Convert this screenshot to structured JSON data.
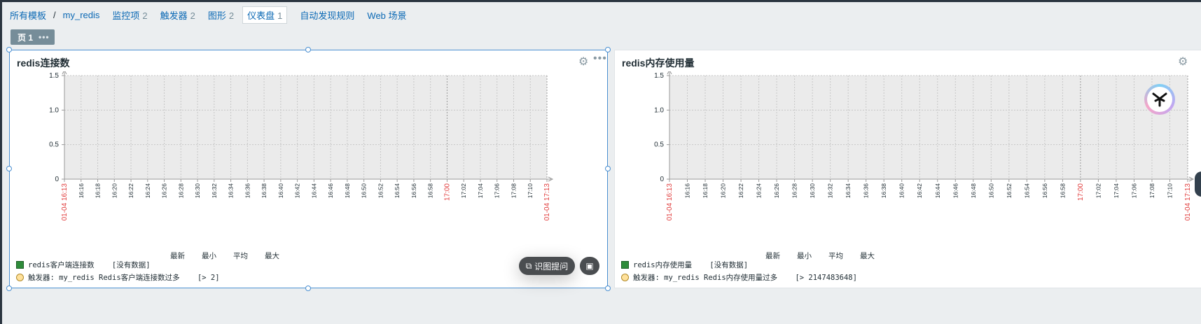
{
  "nav": {
    "all_templates": "所有模板",
    "separator": "/",
    "template_name": "my_redis",
    "items": [
      {
        "label": "监控项",
        "count": "2"
      },
      {
        "label": "触发器",
        "count": "2"
      },
      {
        "label": "图形",
        "count": "2"
      },
      {
        "label": "仪表盘",
        "count": "1"
      },
      {
        "label": "自动发现规则",
        "count": ""
      },
      {
        "label": "Web 场景",
        "count": ""
      }
    ]
  },
  "page_tab": {
    "label": "页 1",
    "more": "•••"
  },
  "widgets": [
    {
      "title": "redis连接数",
      "legend_header": [
        "最新",
        "最小",
        "平均",
        "最大"
      ],
      "item": {
        "name": "redis客户端连接数",
        "status": "[没有数据]"
      },
      "trigger": {
        "label": "触发器: my_redis Redis客户端连接数过多",
        "condition": "[> 2]"
      }
    },
    {
      "title": "redis内存使用量",
      "legend_header": [
        "最新",
        "最小",
        "平均",
        "最大"
      ],
      "item": {
        "name": "redis内存使用量",
        "status": "[没有数据]"
      },
      "trigger": {
        "label": "触发器: my_redis Redis内存使用量过多",
        "condition": "[> 2147483648]"
      }
    }
  ],
  "chart_data": [
    {
      "type": "line",
      "title": "redis连接数",
      "y_ticks": [
        "1.5",
        "1.0",
        "0.5",
        "0"
      ],
      "ylim": [
        0,
        1.5
      ],
      "x_ticks": [
        "01-04 16:13",
        "16:16",
        "16:18",
        "16:20",
        "16:22",
        "16:24",
        "16:26",
        "16:28",
        "16:30",
        "16:32",
        "16:34",
        "16:36",
        "16:38",
        "16:40",
        "16:42",
        "16:44",
        "16:46",
        "16:48",
        "16:50",
        "16:52",
        "16:54",
        "16:56",
        "16:58",
        "17:00",
        "17:02",
        "17:04",
        "17:06",
        "17:08",
        "17:10",
        "01-04 17:13"
      ],
      "x_highlight": [
        "01-04 16:13",
        "17:00",
        "01-04 17:13"
      ],
      "highlight_color": "#e03a3a",
      "grid": true,
      "series": []
    },
    {
      "type": "line",
      "title": "redis内存使用量",
      "y_ticks": [
        "1.5",
        "1.0",
        "0.5",
        "0"
      ],
      "ylim": [
        0,
        1.5
      ],
      "x_ticks": [
        "01-04 16:13",
        "16:16",
        "16:18",
        "16:20",
        "16:22",
        "16:24",
        "16:26",
        "16:28",
        "16:30",
        "16:32",
        "16:34",
        "16:36",
        "16:38",
        "16:40",
        "16:42",
        "16:44",
        "16:46",
        "16:48",
        "16:50",
        "16:52",
        "16:54",
        "16:56",
        "16:58",
        "17:00",
        "17:02",
        "17:04",
        "17:06",
        "17:08",
        "17:10",
        "01-04 17:13"
      ],
      "x_highlight": [
        "01-04 16:13",
        "17:00",
        "01-04 17:13"
      ],
      "highlight_color": "#e03a3a",
      "grid": true,
      "series": []
    }
  ],
  "overlay": {
    "ocr_label": "识图提问",
    "ocr_icon": "scan-icon",
    "image_icon": "image-search-icon",
    "assistant_icon": "assistant-logo-icon"
  },
  "icons": {
    "gear": "gear-icon",
    "more": "more-dots-icon"
  },
  "colors": {
    "link": "#0a68b4",
    "accent_border": "#4a8fd1",
    "series": "#2e8b3a",
    "trigger": "#ffe19b"
  }
}
